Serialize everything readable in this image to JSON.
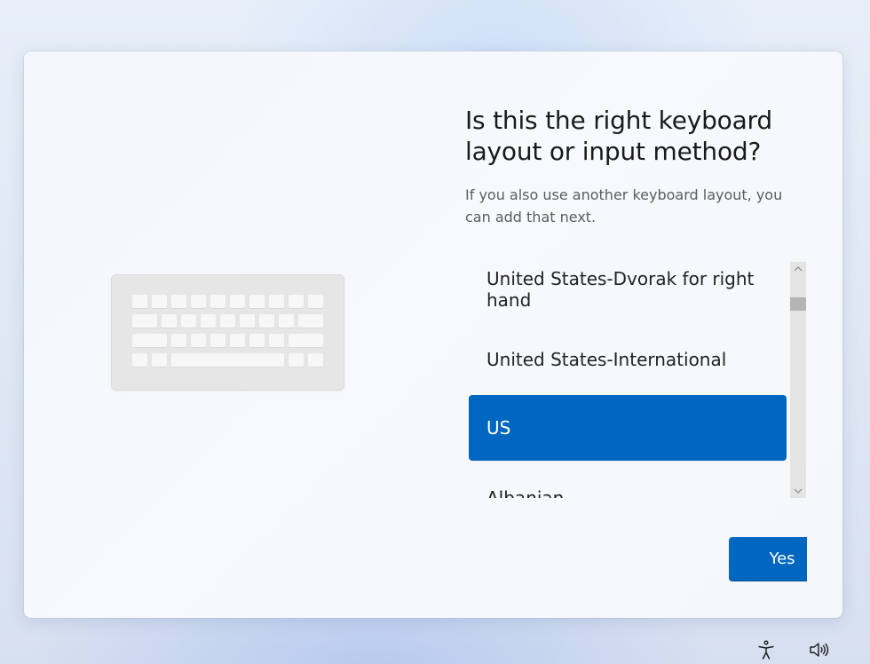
{
  "setup": {
    "heading": "Is this the right keyboard layout or input method?",
    "subtext": "If you also use another keyboard layout, you can add that next."
  },
  "layouts": {
    "items": [
      "United States-Dvorak for right hand",
      "United States-International",
      "US",
      "Albanian"
    ],
    "selected": "US"
  },
  "actions": {
    "yes_label": "Yes"
  },
  "colors": {
    "accent": "#0067c0",
    "scrollbar_track": "#e4e4e4"
  },
  "icons": {
    "illustration": "keyboard-illustration",
    "accessibility": "accessibility-icon",
    "volume": "volume-icon",
    "scroll_up": "chevron-up-icon",
    "scroll_down": "chevron-down-icon"
  }
}
